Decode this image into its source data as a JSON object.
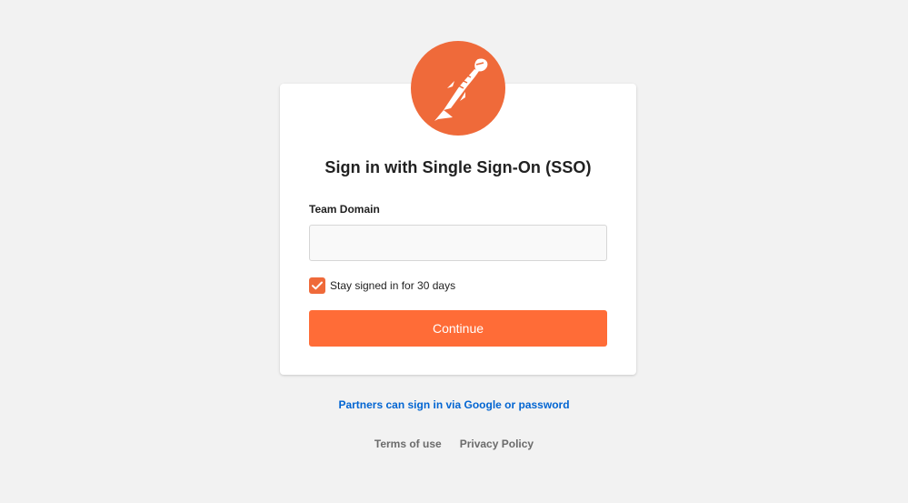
{
  "brand": {
    "logo_icon": "postman-astronaut-icon",
    "accent_color": "#ef6a3a",
    "button_color": "#ff6c37",
    "link_color": "#0265d2"
  },
  "form": {
    "title": "Sign in with Single Sign-On (SSO)",
    "team_domain_label": "Team Domain",
    "team_domain_value": "",
    "team_domain_placeholder": "",
    "stay_signed_in_label": "Stay signed in for 30 days",
    "stay_signed_in_checked": true,
    "continue_label": "Continue"
  },
  "links": {
    "partners": "Partners can sign in via Google or password"
  },
  "footer": {
    "terms": "Terms of use",
    "privacy": "Privacy Policy"
  }
}
